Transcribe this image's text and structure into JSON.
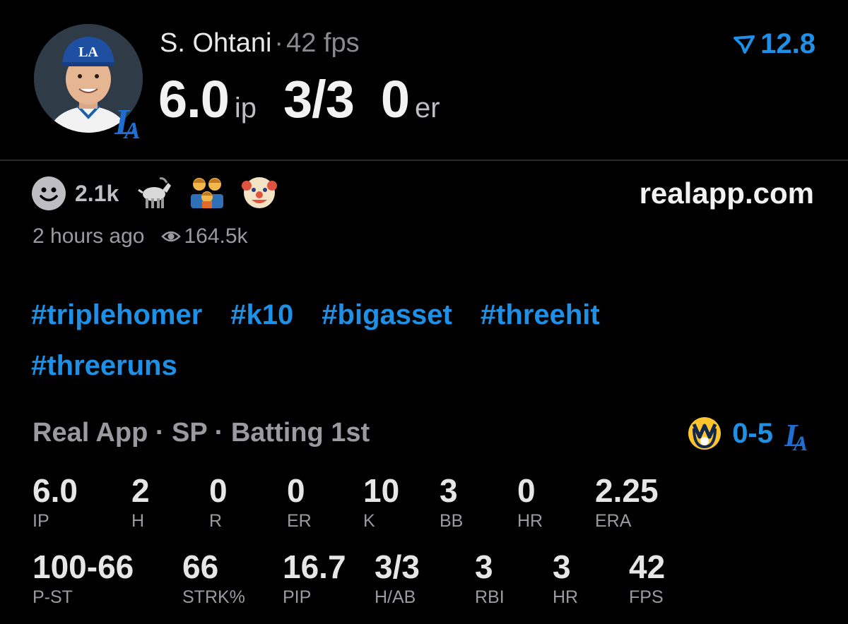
{
  "header": {
    "player_name": "S. Ohtani",
    "separator": "·",
    "fps_text": "42 fps",
    "ip_value": "6.0",
    "ip_unit": "ip",
    "hits_ab": "3/3",
    "er_value": "0",
    "er_unit": "er",
    "score": "12.8",
    "score_icon": "real-logo-icon"
  },
  "reactions": {
    "smile_count": "2.1k",
    "emojis": [
      "goat",
      "family",
      "clown"
    ]
  },
  "site": "realapp.com",
  "meta": {
    "posted": "2 hours ago",
    "views": "164.5k"
  },
  "tags": [
    "#triplehomer",
    "#k10",
    "#bigasset",
    "#threehit",
    "#threeruns"
  ],
  "game": {
    "info": "Real App · SP · Batting 1st",
    "score": "0-5"
  },
  "stats_row1": [
    {
      "value": "6.0",
      "label": "IP"
    },
    {
      "value": "2",
      "label": "H"
    },
    {
      "value": "0",
      "label": "R"
    },
    {
      "value": "0",
      "label": "ER"
    },
    {
      "value": "10",
      "label": "K"
    },
    {
      "value": "3",
      "label": "BB"
    },
    {
      "value": "0",
      "label": "HR"
    },
    {
      "value": "2.25",
      "label": "ERA"
    }
  ],
  "stats_row2": [
    {
      "value": "100-66",
      "label": "P-ST"
    },
    {
      "value": "66",
      "label": "STRK%"
    },
    {
      "value": "16.7",
      "label": "PIP"
    },
    {
      "value": "3/3",
      "label": "H/AB"
    },
    {
      "value": "3",
      "label": "RBI"
    },
    {
      "value": "3",
      "label": "HR"
    },
    {
      "value": "42",
      "label": "FPS"
    }
  ],
  "colors": {
    "accent": "#1e90e6",
    "dodgers_blue": "#005a9c",
    "brewers_gold": "#ffc52f",
    "brewers_navy": "#12284b"
  }
}
